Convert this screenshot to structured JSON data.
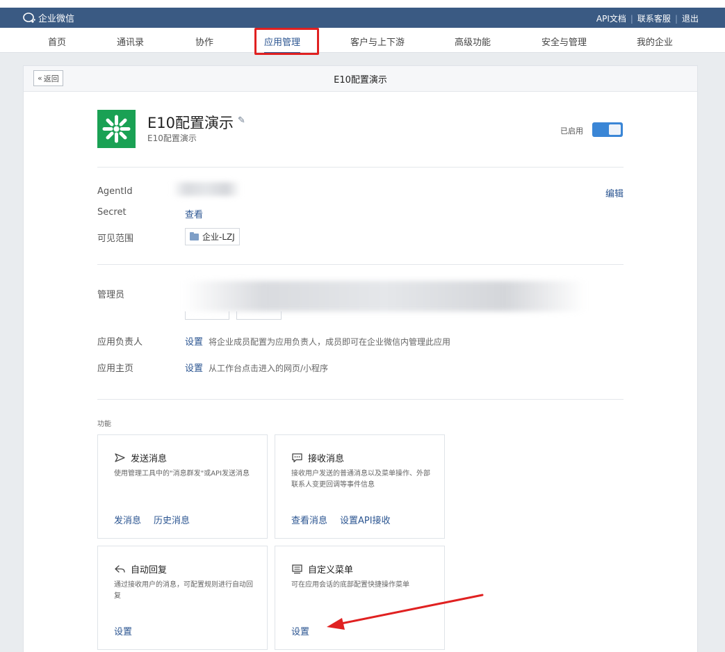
{
  "topbar": {
    "brand": "企业微信",
    "links": [
      "API文档",
      "联系客服",
      "退出"
    ]
  },
  "nav": {
    "items": [
      "首页",
      "通讯录",
      "协作",
      "应用管理",
      "客户与上下游",
      "高级功能",
      "安全与管理",
      "我的企业"
    ],
    "active": "应用管理"
  },
  "panel": {
    "back_label": "返回",
    "title": "E10配置演示"
  },
  "app": {
    "name": "E10配置演示",
    "subtitle": "E10配置演示",
    "status_label": "已启用",
    "enabled": true
  },
  "details": {
    "agentid_label": "AgentId",
    "secret_label": "Secret",
    "secret_link": "查看",
    "scope_label": "可见范围",
    "scope_value": "企业-LZJ",
    "edit_link": "编辑"
  },
  "admin": {
    "admin_label": "管理员",
    "owner_label": "应用负责人",
    "owner_link": "设置",
    "owner_desc": "将企业成员配置为应用负责人，成员即可在企业微信内管理此应用",
    "home_label": "应用主页",
    "home_link": "设置",
    "home_desc": "从工作台点击进入的网页/小程序"
  },
  "features": {
    "section_label": "功能",
    "cards": [
      {
        "icon": "send-icon",
        "title": "发送消息",
        "desc": "使用管理工具中的\"消息群发\"或API发送消息",
        "links": [
          "发消息",
          "历史消息"
        ]
      },
      {
        "icon": "chat-bubble-icon",
        "title": "接收消息",
        "desc": "接收用户发送的普通消息以及菜单操作、外部联系人变更回调等事件信息",
        "links": [
          "查看消息",
          "设置API接收"
        ]
      },
      {
        "icon": "reply-icon",
        "title": "自动回复",
        "desc": "通过接收用户的消息，可配置规则进行自动回复",
        "links": [
          "设置"
        ]
      },
      {
        "icon": "menu-icon",
        "title": "自定义菜单",
        "desc": "可在应用会话的底部配置快捷操作菜单",
        "links": [
          "设置"
        ]
      }
    ]
  },
  "colors": {
    "topbar": "#3a5a83",
    "link": "#2b5591",
    "toggle": "#3a86d6",
    "app_logo": "#1aa154",
    "annotation": "#e02121"
  }
}
